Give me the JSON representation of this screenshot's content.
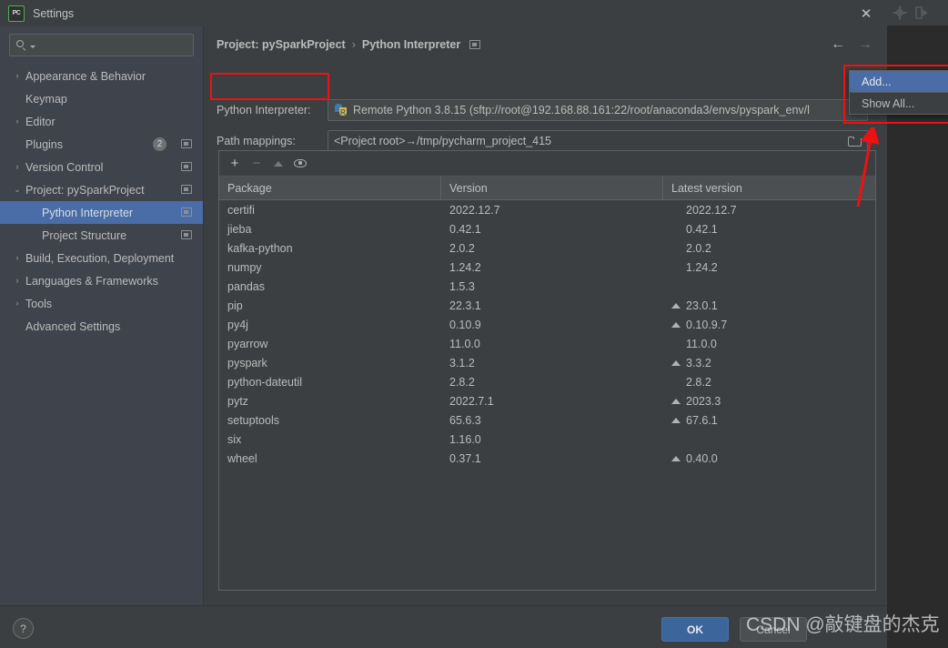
{
  "window": {
    "title": "Settings",
    "app_icon": "pycharm-icon",
    "close_icon": "close-icon"
  },
  "search": {
    "value": "",
    "placeholder": "",
    "icon": "search-icon"
  },
  "sidebar": {
    "items": [
      {
        "label": "Appearance & Behavior",
        "arrow": "›",
        "indent": false,
        "selected": false,
        "marker": false,
        "badge": null
      },
      {
        "label": "Keymap",
        "arrow": "",
        "indent": false,
        "selected": false,
        "marker": false,
        "badge": null
      },
      {
        "label": "Editor",
        "arrow": "›",
        "indent": false,
        "selected": false,
        "marker": false,
        "badge": null
      },
      {
        "label": "Plugins",
        "arrow": "",
        "indent": false,
        "selected": false,
        "marker": true,
        "badge": "2"
      },
      {
        "label": "Version Control",
        "arrow": "›",
        "indent": false,
        "selected": false,
        "marker": true,
        "badge": null
      },
      {
        "label": "Project: pySparkProject",
        "arrow": "⌄",
        "indent": false,
        "selected": false,
        "marker": true,
        "badge": null
      },
      {
        "label": "Python Interpreter",
        "arrow": "",
        "indent": true,
        "selected": true,
        "marker": true,
        "badge": null
      },
      {
        "label": "Project Structure",
        "arrow": "",
        "indent": true,
        "selected": false,
        "marker": true,
        "badge": null
      },
      {
        "label": "Build, Execution, Deployment",
        "arrow": "›",
        "indent": false,
        "selected": false,
        "marker": false,
        "badge": null
      },
      {
        "label": "Languages & Frameworks",
        "arrow": "›",
        "indent": false,
        "selected": false,
        "marker": false,
        "badge": null
      },
      {
        "label": "Tools",
        "arrow": "›",
        "indent": false,
        "selected": false,
        "marker": false,
        "badge": null
      },
      {
        "label": "Advanced Settings",
        "arrow": "",
        "indent": false,
        "selected": false,
        "marker": false,
        "badge": null
      }
    ]
  },
  "content": {
    "breadcrumb": {
      "parent": "Project: pySparkProject",
      "separator": "›",
      "current": "Python Interpreter"
    },
    "nav": {
      "back_icon": "arrow-left-icon",
      "forward_icon": "arrow-right-icon"
    },
    "interpreter": {
      "label": "Python Interpreter:",
      "icon": "python-remote-icon",
      "value": "Remote Python 3.8.15 (sftp://root@192.168.88.161:22/root/anaconda3/envs/pyspark_env/l"
    },
    "path_mappings": {
      "label": "Path mappings:",
      "value": "<Project root>→/tmp/pycharm_project_415",
      "browse_icon": "folder-icon"
    },
    "toolbar": {
      "add_icon": "plus-icon",
      "remove_icon": "minus-icon",
      "upgrade_icon": "upgrade-triangle-icon",
      "show_early_icon": "eye-icon"
    },
    "table": {
      "columns": [
        "Package",
        "Version",
        "Latest version"
      ],
      "rows": [
        {
          "package": "certifi",
          "version": "2022.12.7",
          "latest": "2022.12.7",
          "upgradable": false
        },
        {
          "package": "jieba",
          "version": "0.42.1",
          "latest": "0.42.1",
          "upgradable": false
        },
        {
          "package": "kafka-python",
          "version": "2.0.2",
          "latest": "2.0.2",
          "upgradable": false
        },
        {
          "package": "numpy",
          "version": "1.24.2",
          "latest": "1.24.2",
          "upgradable": false
        },
        {
          "package": "pandas",
          "version": "1.5.3",
          "latest": "",
          "upgradable": false
        },
        {
          "package": "pip",
          "version": "22.3.1",
          "latest": "23.0.1",
          "upgradable": true
        },
        {
          "package": "py4j",
          "version": "0.10.9",
          "latest": "0.10.9.7",
          "upgradable": true
        },
        {
          "package": "pyarrow",
          "version": "11.0.0",
          "latest": "11.0.0",
          "upgradable": false
        },
        {
          "package": "pyspark",
          "version": "3.1.2",
          "latest": "3.3.2",
          "upgradable": true
        },
        {
          "package": "python-dateutil",
          "version": "2.8.2",
          "latest": "2.8.2",
          "upgradable": false
        },
        {
          "package": "pytz",
          "version": "2022.7.1",
          "latest": "2023.3",
          "upgradable": true
        },
        {
          "package": "setuptools",
          "version": "65.6.3",
          "latest": "67.6.1",
          "upgradable": true
        },
        {
          "package": "six",
          "version": "1.16.0",
          "latest": "",
          "upgradable": false
        },
        {
          "package": "wheel",
          "version": "0.37.1",
          "latest": "0.40.0",
          "upgradable": true
        }
      ]
    }
  },
  "popup_menu": {
    "items": [
      {
        "label": "Add...",
        "selected": true
      },
      {
        "label": "Show All...",
        "selected": false
      }
    ]
  },
  "footer": {
    "help_label": "?",
    "ok_label": "OK",
    "cancel_label": "Cancel"
  },
  "watermark": {
    "text": "CSDN @敲键盘的杰克"
  },
  "colors": {
    "dialog_bg": "#3c3f41",
    "sidebar_bg": "#3f434c",
    "selection_blue": "#4a6da7",
    "ok_button": "#3c659c",
    "annotation_red": "#ee1111",
    "text": "#bbbbbb"
  }
}
